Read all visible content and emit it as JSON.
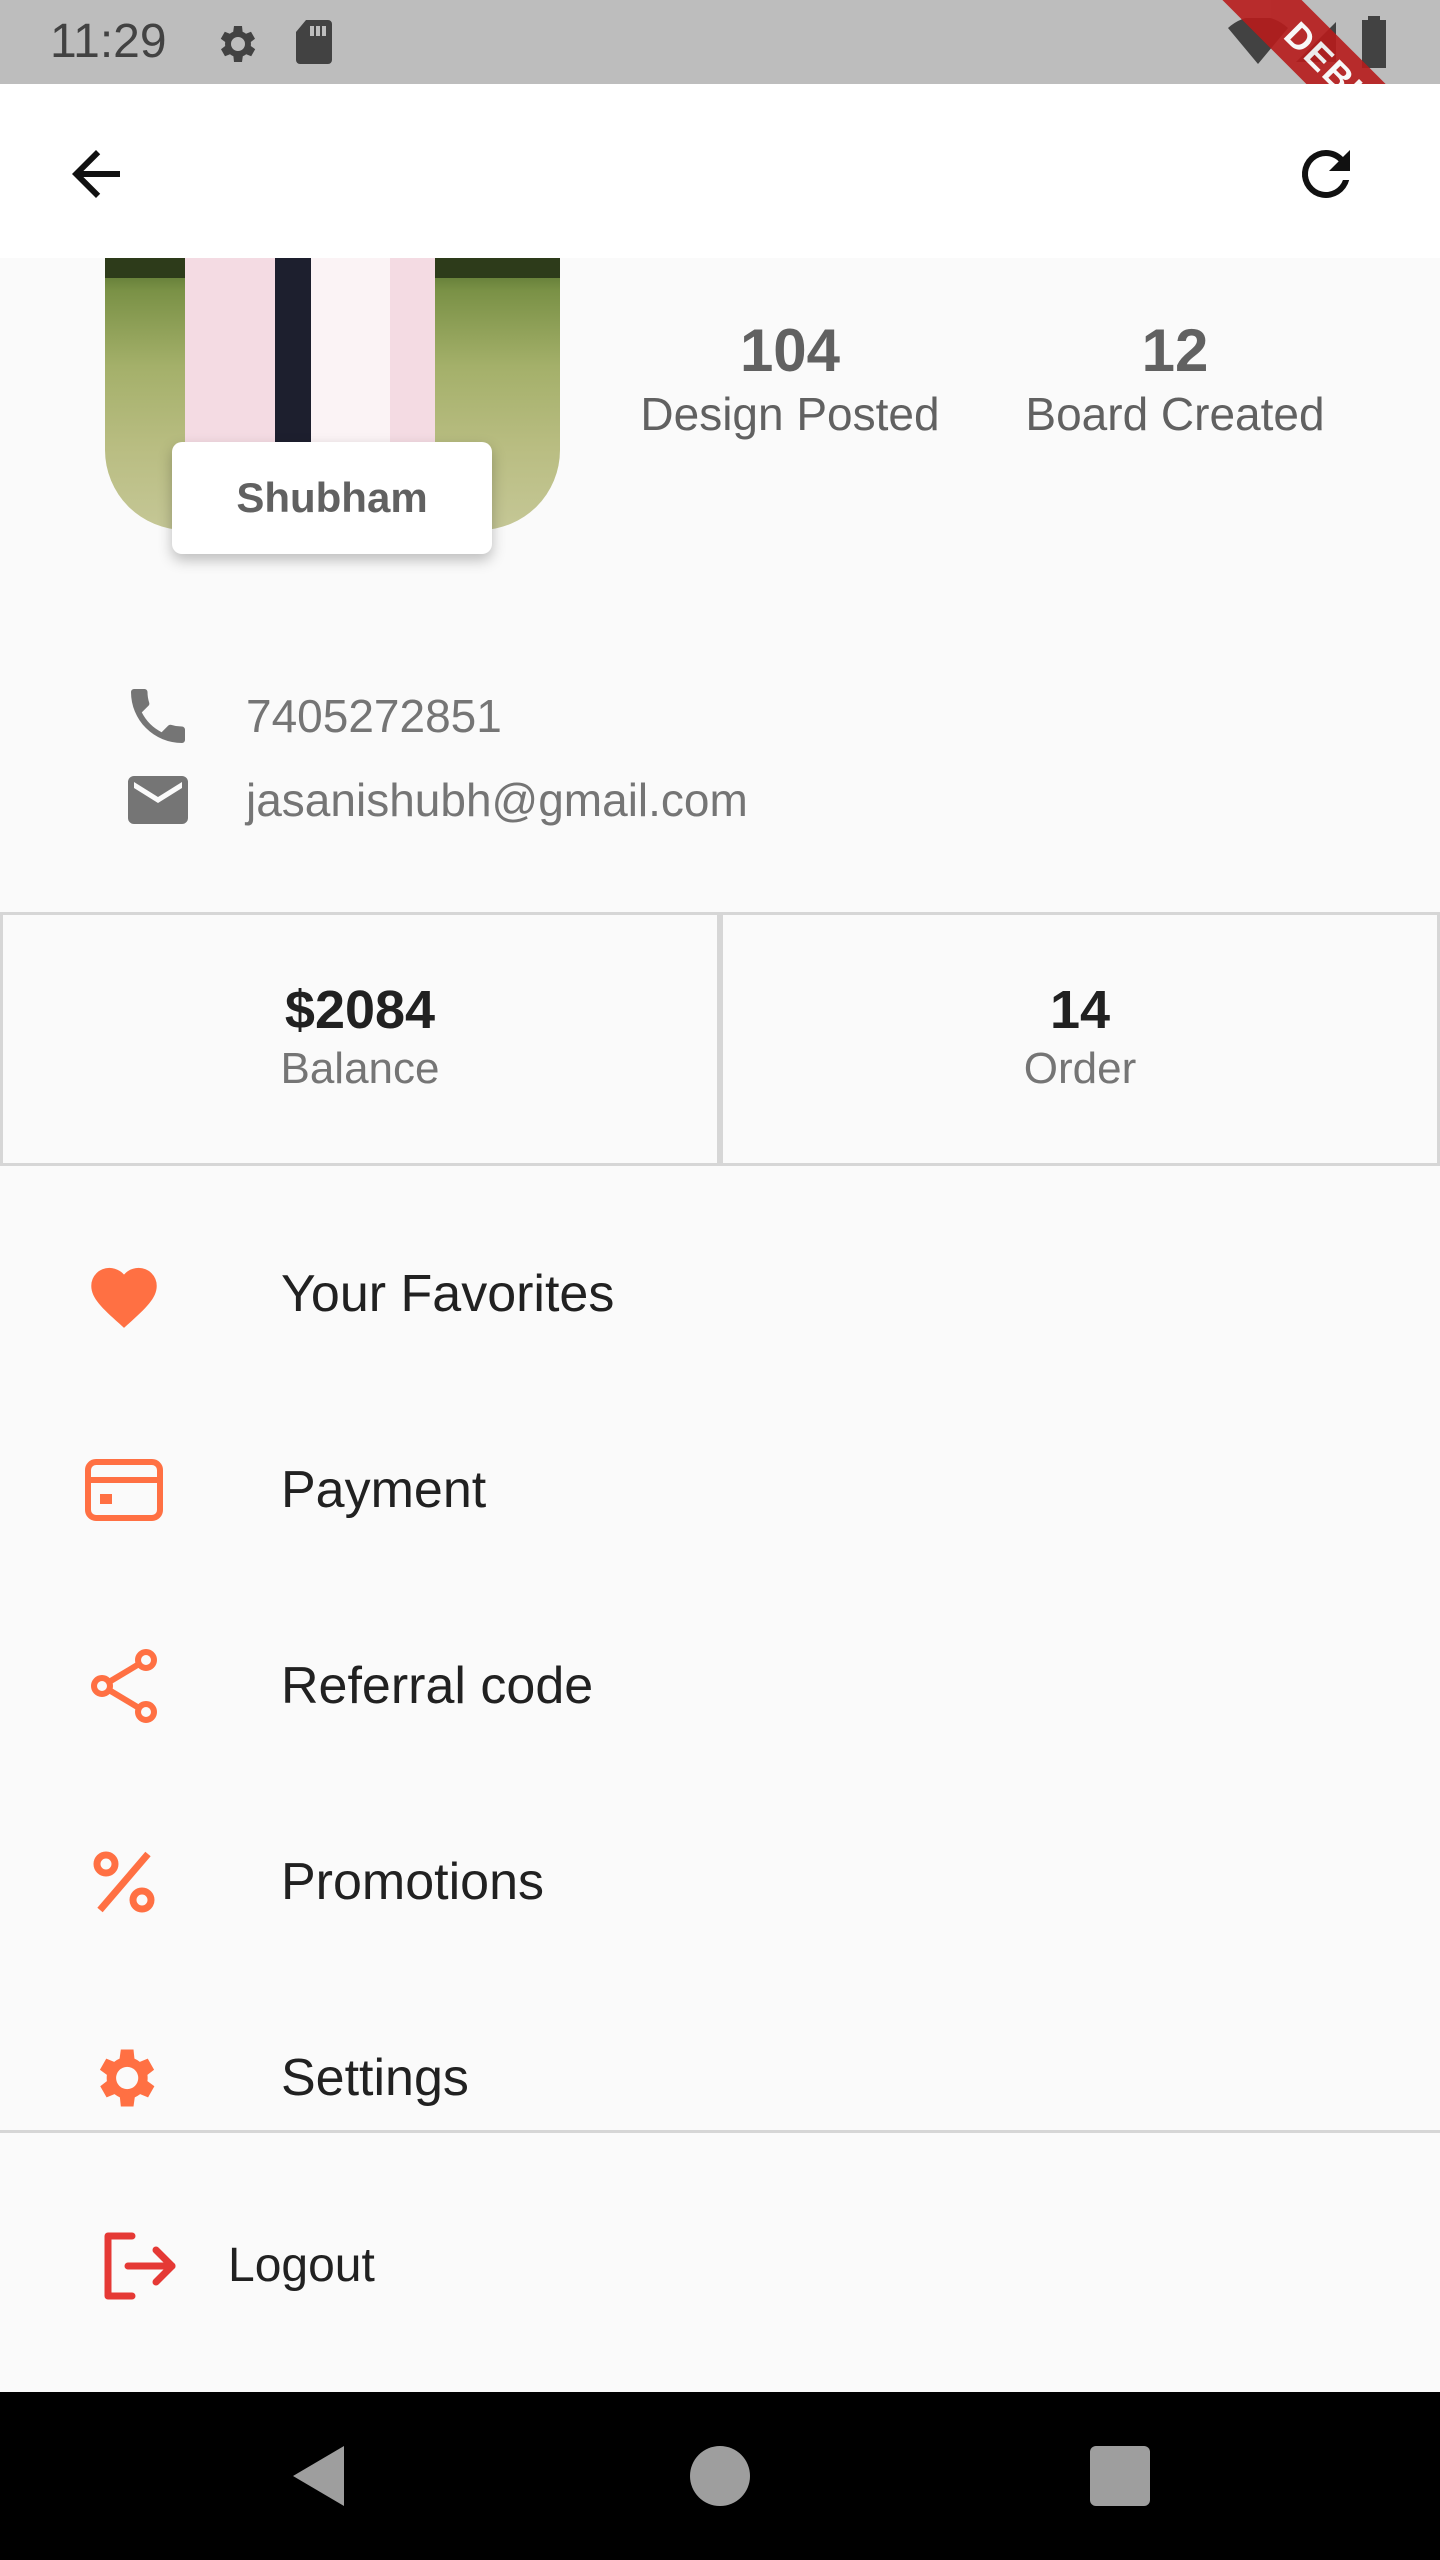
{
  "status_bar": {
    "time": "11:29",
    "debug_label": "DEBUG"
  },
  "app_bar": {
    "back_icon": "arrow-back-icon",
    "refresh_icon": "refresh-icon"
  },
  "profile": {
    "name": "Shubham",
    "stats": [
      {
        "value": "104",
        "label": "Design Posted"
      },
      {
        "value": "12",
        "label": "Board Created"
      }
    ],
    "phone": "7405272851",
    "email": "jasanishubh@gmail.com"
  },
  "summary": {
    "balance_value": "$2084",
    "balance_label": "Balance",
    "order_value": "14",
    "order_label": "Order"
  },
  "menu": [
    {
      "label": "Your Favorites",
      "icon": "heart-icon"
    },
    {
      "label": "Payment",
      "icon": "credit-card-icon"
    },
    {
      "label": "Referral code",
      "icon": "share-icon"
    },
    {
      "label": "Promotions",
      "icon": "percent-icon"
    },
    {
      "label": "Settings",
      "icon": "gear-icon"
    }
  ],
  "logout": {
    "label": "Logout",
    "icon": "logout-icon"
  },
  "colors": {
    "accent": "#ff7043",
    "logout_red": "#e53935"
  }
}
